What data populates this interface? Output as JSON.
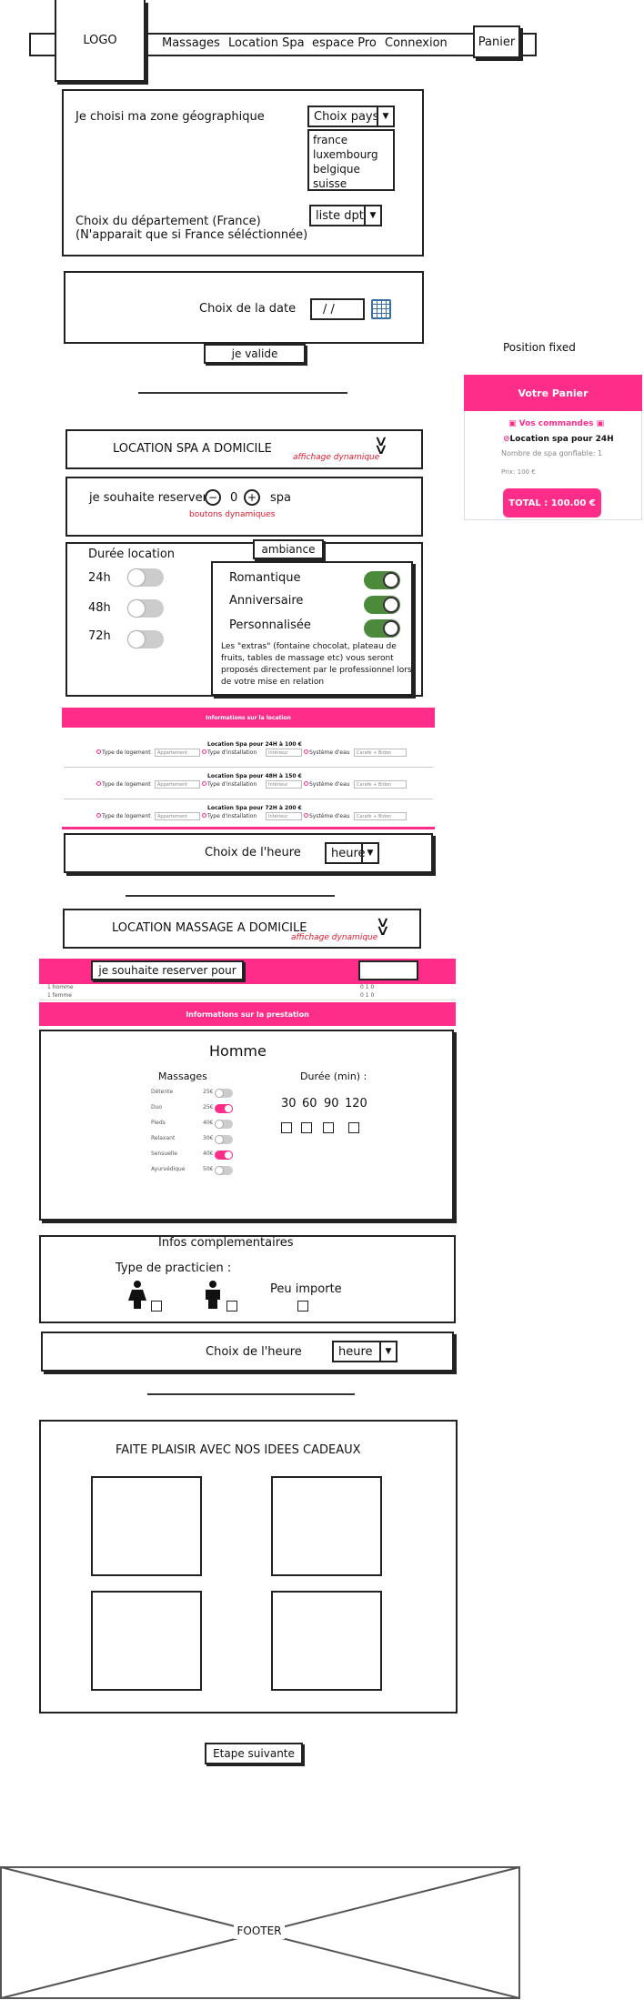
{
  "header": {
    "logo": "LOGO",
    "nav": [
      "Massages",
      "Location Spa",
      "espace Pro",
      "Connexion"
    ],
    "cart": "Panier"
  },
  "zone": {
    "label": "Je choisi ma zone géographique",
    "country_select": "Choix pays",
    "countries": [
      "france",
      "luxembourg",
      "belgique",
      "suisse"
    ],
    "dept_label_1": "Choix du département (France)",
    "dept_label_2": "(N'apparait que si France séléctionnée)",
    "dept_select": "liste dpt"
  },
  "date": {
    "label": "Choix de la date",
    "value": "/ /",
    "validate": "je valide"
  },
  "cart_panel": {
    "position_note": "Position fixed",
    "title": "Votre Panier",
    "orders": "Vos commandes",
    "item": "Location spa pour 24H",
    "count": "Nombre de spa gonflable: 1",
    "price": "Prix: 100 €",
    "total": "TOTAL : 100.00 €"
  },
  "spa": {
    "title": "LOCATION SPA A DOMICILE",
    "dynamic_note": "affichage dynamique",
    "reserve_label": "je souhaite reserver",
    "qty": "0",
    "unit": "spa",
    "buttons_note": "boutons dynamiques",
    "duration_title": "Durée location",
    "durations": [
      "24h",
      "48h",
      "72h"
    ],
    "ambiance_tab": "ambiance",
    "ambiances": [
      "Romantique",
      "Anniversaire",
      "Personnalisée"
    ],
    "extras_text": [
      "Les \"extras\" (fontaine chocolat, plateau de",
      "fruits, tables de massage etc) vous seront",
      "proposés directement par le professionnel lors",
      "de votre mise en relation"
    ],
    "info_bar": "Informations sur la location",
    "rows": [
      {
        "title": "Location Spa pour 24H à 100 €",
        "items": [
          "Type de logement",
          "Appartement",
          "Type d'installation",
          "Intérieur",
          "Système d'eau",
          "Carafe + Bidon"
        ]
      },
      {
        "title": "Location Spa pour 48H à 150 €",
        "items": [
          "Type de logement",
          "Appartement",
          "Type d'installation",
          "Intérieur",
          "Système d'eau",
          "Carafe + Bidon"
        ]
      },
      {
        "title": "Location Spa pour 72H à 200 €",
        "items": [
          "Type de logement",
          "Appartement",
          "Type d'installation",
          "Intérieur",
          "Système d'eau",
          "Carafe + Bidon"
        ]
      }
    ],
    "hour_label": "Choix de l'heure",
    "hour_select": "heure"
  },
  "massage": {
    "title": "LOCATION MASSAGE A DOMICILE",
    "dynamic_note": "affichage dynamique",
    "reserve_label": "je souhaite reserver pour",
    "person_rows": [
      "1 homme",
      "1 femme"
    ],
    "person_counts": [
      "0 1 0",
      "0 1 0"
    ],
    "info_bar": "Informations sur la prestation",
    "gender_title": "Homme",
    "massages_title": "Massages",
    "massages": [
      {
        "name": "Détente",
        "price": "25€"
      },
      {
        "name": "Duo",
        "price": "25€"
      },
      {
        "name": "Pieds",
        "price": "40€"
      },
      {
        "name": "Relaxant",
        "price": "30€"
      },
      {
        "name": "Sensuelle",
        "price": "40€"
      },
      {
        "name": "Ayurvédique",
        "price": "50€"
      }
    ],
    "massage_states": [
      false,
      true,
      false,
      false,
      true,
      false
    ],
    "duration_title": "Durée (min) :",
    "durations": [
      "30",
      "60",
      "90",
      "120"
    ],
    "infos_title": "Infos complementaires",
    "practitioner_label": "Type de practicien :",
    "any_label": "Peu importe",
    "hour_label": "Choix de l'heure",
    "hour_select": "heure"
  },
  "gifts": {
    "title": "FAITE PLAISIR AVEC NOS IDEES CADEAUX"
  },
  "next_step": "Etape suivante",
  "footer": "FOOTER"
}
